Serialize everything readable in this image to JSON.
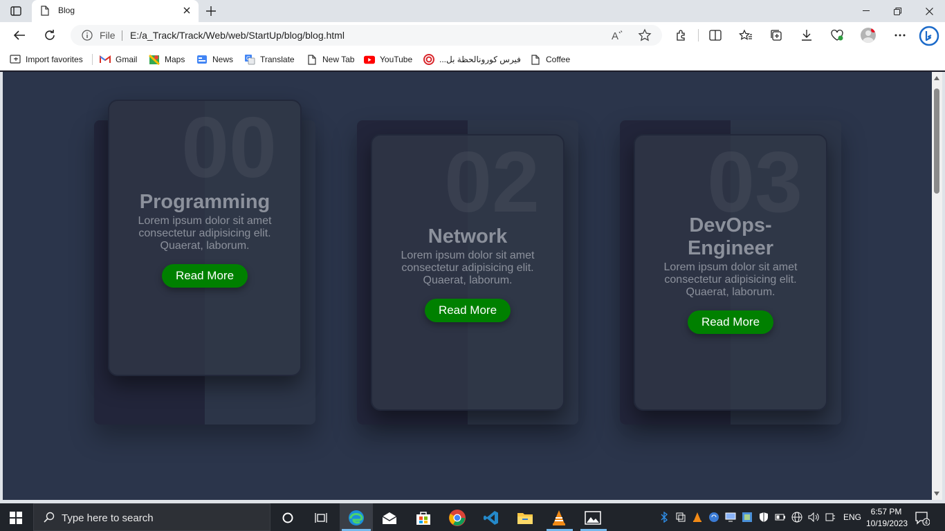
{
  "browser": {
    "tab_title": "Blog",
    "address_scheme": "File",
    "address_url": "E:/a_Track/Track/Web/web/StartUp/blog/blog.html"
  },
  "favorites": [
    {
      "label": "Import favorites",
      "icon": "import-icon"
    },
    {
      "label": "Gmail",
      "icon": "gmail-icon"
    },
    {
      "label": "Maps",
      "icon": "maps-icon"
    },
    {
      "label": "News",
      "icon": "news-icon"
    },
    {
      "label": "Translate",
      "icon": "translate-icon"
    },
    {
      "label": "New Tab",
      "icon": "page-icon"
    },
    {
      "label": "YouTube",
      "icon": "youtube-icon"
    },
    {
      "label": "...فيرس كورونالحظة بل",
      "icon": "target-icon"
    },
    {
      "label": "Coffee",
      "icon": "page-icon"
    }
  ],
  "cards": [
    {
      "number": "00",
      "title": "Programming",
      "text": "Lorem ipsum dolor sit amet consectetur adipisicing elit. Quaerat, laborum.",
      "button": "Read More"
    },
    {
      "number": "02",
      "title": "Network",
      "text": "Lorem ipsum dolor sit amet consectetur adipisicing elit. Quaerat, laborum.",
      "button": "Read More"
    },
    {
      "number": "03",
      "title": "DevOps-Engineer",
      "text": "Lorem ipsum dolor sit amet consectetur adipisicing elit. Quaerat, laborum.",
      "button": "Read More"
    }
  ],
  "taskbar": {
    "search_placeholder": "Type here to search",
    "language": "ENG",
    "time": "6:57 PM",
    "date": "10/19/2023",
    "notification_count": "4"
  },
  "colors": {
    "page_background": "#2b354b",
    "button": "#008000",
    "card_text": "#8c919c"
  }
}
